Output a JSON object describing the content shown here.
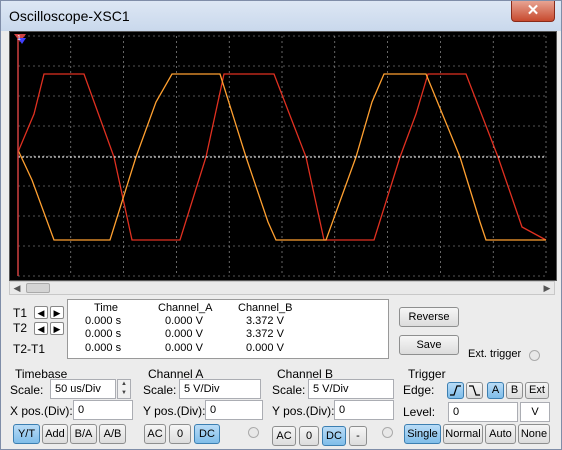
{
  "window": {
    "title": "Oscilloscope-XSC1",
    "close_label": "✕"
  },
  "scope": {
    "colors": {
      "background": "#000000",
      "grid": "#aaaaaa",
      "axis": "#ffffff",
      "channel_a": "#e03020",
      "channel_b": "#ffa030",
      "cursor_1": "#d04040",
      "cursor_2": "#4040ff"
    },
    "cursor_labels": {
      "c1": "1",
      "c2": "2"
    }
  },
  "cursors": {
    "t1": "T1",
    "t2": "T2",
    "t2_t1": "T2-T1"
  },
  "readout": {
    "headers": [
      "Time",
      "Channel_A",
      "Channel_B"
    ],
    "rows": [
      [
        "0.000 s",
        "0.000 V",
        "3.372 V"
      ],
      [
        "0.000 s",
        "0.000 V",
        "3.372 V"
      ],
      [
        "0.000 s",
        "0.000 V",
        "0.000 V"
      ]
    ]
  },
  "buttons": {
    "reverse": "Reverse",
    "save": "Save",
    "ext_trigger": "Ext. trigger"
  },
  "timebase": {
    "title": "Timebase",
    "scale_label": "Scale:",
    "scale_value": "50 us/Div",
    "xpos_label": "X pos.(Div):",
    "xpos_value": "0",
    "modes": [
      "Y/T",
      "Add",
      "B/A",
      "A/B"
    ],
    "selected_mode": "Y/T"
  },
  "channel_a": {
    "title": "Channel A",
    "scale_label": "Scale:",
    "scale_value": "5  V/Div",
    "ypos_label": "Y pos.(Div):",
    "ypos_value": "0",
    "couplings": [
      "AC",
      "0",
      "DC"
    ],
    "selected": "DC"
  },
  "channel_b": {
    "title": "Channel B",
    "scale_label": "Scale:",
    "scale_value": "5  V/Div",
    "ypos_label": "Y pos.(Div):",
    "ypos_value": "0",
    "couplings": [
      "AC",
      "0",
      "DC",
      "-"
    ],
    "selected": "DC"
  },
  "trigger": {
    "title": "Trigger",
    "edge_label": "Edge:",
    "edge_sources": [
      "A",
      "B",
      "Ext"
    ],
    "selected_source": "A",
    "level_label": "Level:",
    "level_value": "0",
    "level_unit": "V",
    "modes": [
      "Single",
      "Normal",
      "Auto",
      "None"
    ],
    "selected_mode": "Single"
  }
}
